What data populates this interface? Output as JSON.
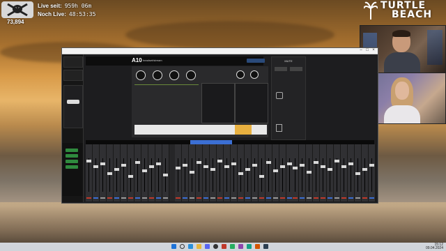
{
  "overlay": {
    "follower_count": "73,894",
    "live_since_label": "Live seit:",
    "live_since_value": "959h 06m",
    "remaining_label": "Noch Live:",
    "remaining_value": "48:53:35"
  },
  "brand": {
    "line1": "TURTLE",
    "line2": "BEACH"
  },
  "mixer_app": {
    "channel_name": "A10",
    "channel_sub": "headset/stream",
    "mute_label": "MUTE",
    "colors": {
      "accent_green": "#2f8a3e",
      "accent_blue": "#3b6fd4",
      "bg": "#1d1d1f"
    }
  },
  "taskbar": {
    "time": "15:12",
    "date": "09.04.2024"
  },
  "icons": [
    "jolly-roger-icon",
    "palm-tree-icon",
    "windows-start-icon",
    "search-icon",
    "browser-icon",
    "folder-icon",
    "discord-icon",
    "obs-icon"
  ]
}
